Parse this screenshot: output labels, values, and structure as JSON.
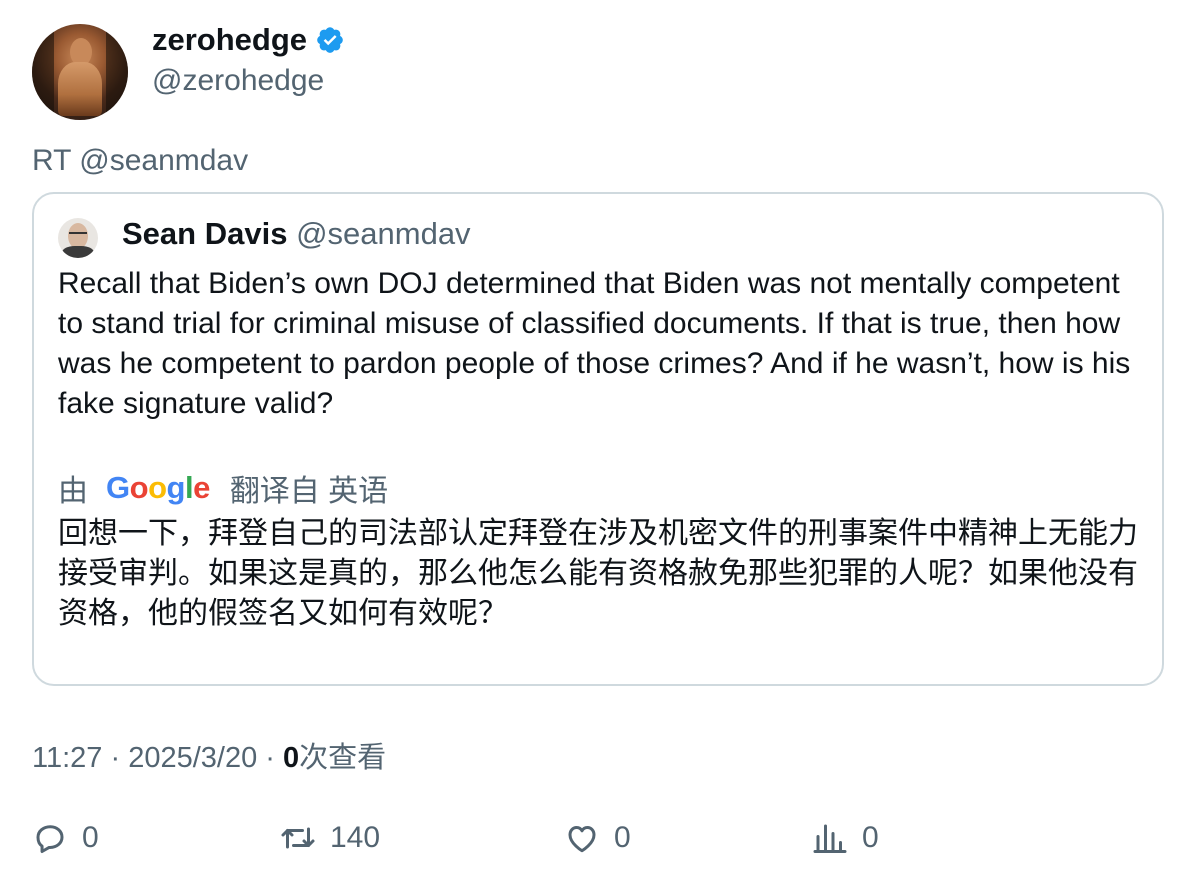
{
  "author": {
    "display_name": "zerohedge",
    "handle": "@zerohedge"
  },
  "retweet_label": "RT @seanmdav",
  "quote": {
    "display_name": "Sean Davis",
    "handle": "@seanmdav",
    "text": "Recall that Biden’s own DOJ determined that Biden was not mentally competent to stand trial for criminal misuse of classified documents. If that is true, then how was he competent to pardon people of those crimes? And if he wasn’t, how is his fake signature valid?",
    "translation": {
      "by_label": "由",
      "provider_logo_letters": [
        "G",
        "o",
        "o",
        "g",
        "l",
        "e"
      ],
      "from_label": "翻译自 英语",
      "translated_text": "回想一下，拜登自己的司法部认定拜登在涉及机密文件的刑事案件中精神上无能力接受审判。如果这是真的，那么他怎么能有资格赦免那些犯罪的人呢？如果他没有资格，他的假签名又如何有效呢？"
    }
  },
  "meta": {
    "time": "11:27",
    "separator": " · ",
    "date": "2025/3/20",
    "views_count": "0",
    "views_label": "次查看"
  },
  "actions": {
    "reply_count": "0",
    "retweet_count": "140",
    "like_count": "0",
    "views_count": "0"
  },
  "colors": {
    "verified": "#1d9bf0",
    "secondary_text": "#536471",
    "border": "#cfd9de"
  }
}
